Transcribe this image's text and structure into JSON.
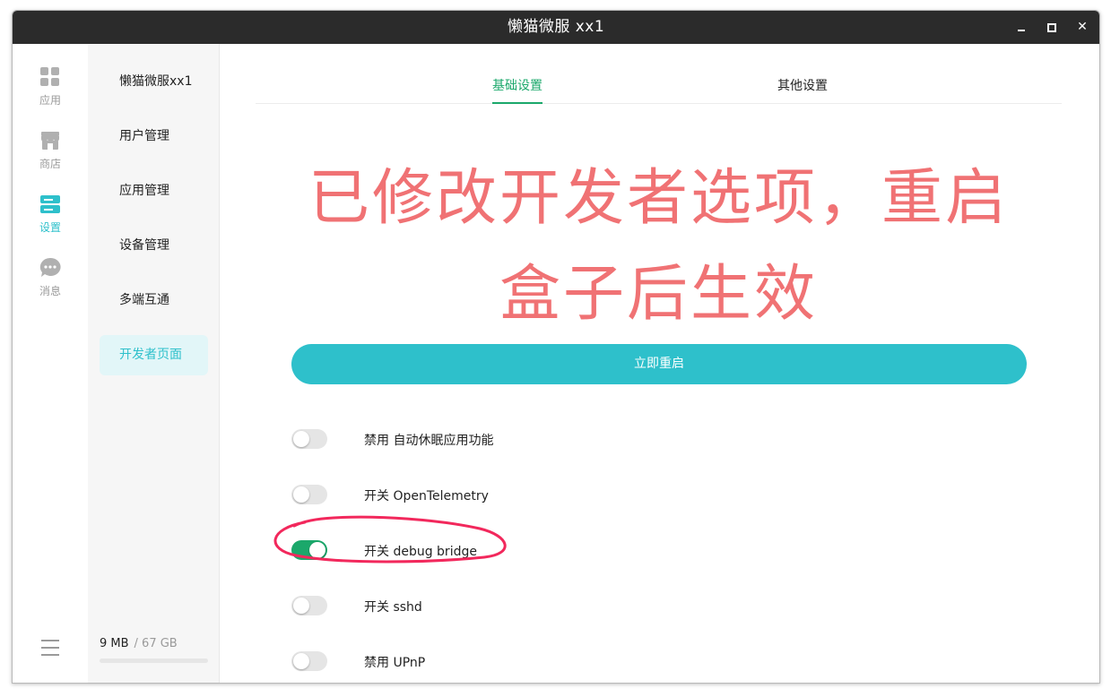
{
  "window": {
    "title": "懒猫微服  xx1",
    "close_symbol": "✕"
  },
  "rail": {
    "items": [
      {
        "label": "应用",
        "icon": "apps-grid-icon"
      },
      {
        "label": "商店",
        "icon": "store-icon"
      },
      {
        "label": "设置",
        "icon": "settings-icon"
      },
      {
        "label": "消息",
        "icon": "message-icon"
      }
    ],
    "active_index": 2
  },
  "sidebar": {
    "items": [
      {
        "label": "懒猫微服xx1"
      },
      {
        "label": "用户管理"
      },
      {
        "label": "应用管理"
      },
      {
        "label": "设备管理"
      },
      {
        "label": "多端互通"
      },
      {
        "label": "开发者页面"
      }
    ],
    "active_index": 5,
    "storage": {
      "used": "9 MB",
      "total": "/ 67 GB"
    }
  },
  "tabs": [
    {
      "label": "基础设置"
    },
    {
      "label": "其他设置"
    }
  ],
  "notice": {
    "line1": "已修改开发者选项，重启",
    "line2": "盒子后生效"
  },
  "restart_button": "立即重启",
  "options": [
    {
      "label": "禁用 自动休眠应用功能",
      "on": false
    },
    {
      "label": "开关 OpenTelemetry",
      "on": false
    },
    {
      "label": "开关 debug bridge",
      "on": true
    },
    {
      "label": "开关 sshd",
      "on": false
    },
    {
      "label": "禁用 UPnP",
      "on": false
    }
  ],
  "colors": {
    "accent": "#2ec0cb",
    "toggle_on": "#1ba86b",
    "notice": "#f07274",
    "annotation": "#f2285c"
  }
}
